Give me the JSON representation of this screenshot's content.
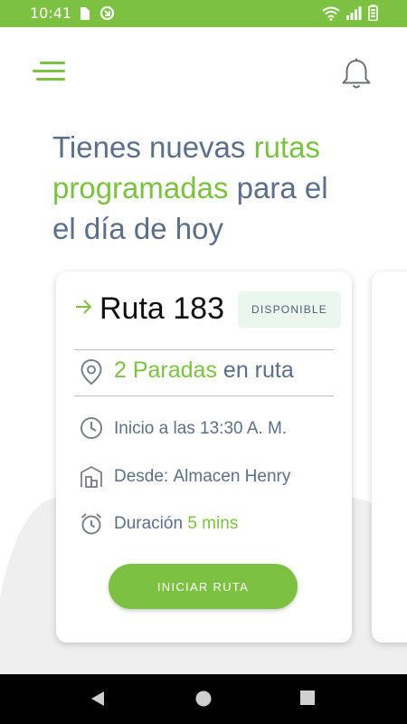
{
  "status_bar": {
    "time": "10:41",
    "icons": [
      "sd-card-icon",
      "sync-icon",
      "wifi-icon",
      "signal-icon",
      "battery-icon"
    ]
  },
  "app_bar": {
    "menu_icon": "hamburger-menu-icon",
    "bell_icon": "bell-icon"
  },
  "headline": {
    "part1": "Tienes nuevas ",
    "accent": "rutas programadas",
    "part2": " para el el día de hoy"
  },
  "route_card": {
    "title": "Ruta 183",
    "status": "DISPONIBLE",
    "stops_count": "2 Paradas",
    "stops_suffix": " en ruta",
    "start_time": "Inicio a las 13:30 A. M.",
    "from_label": "Desde:",
    "from_value": "Almacen Henry",
    "duration_label": "Duración",
    "duration_value": "5 mins",
    "button_label": "INICIAR RUTA"
  },
  "nav_bar": {
    "back": "back-triangle-icon",
    "home": "home-circle-icon",
    "recents": "recents-square-icon"
  },
  "colors": {
    "accent": "#7cc142",
    "text": "#5b6f8a",
    "badge_bg": "#eaf6ee"
  }
}
